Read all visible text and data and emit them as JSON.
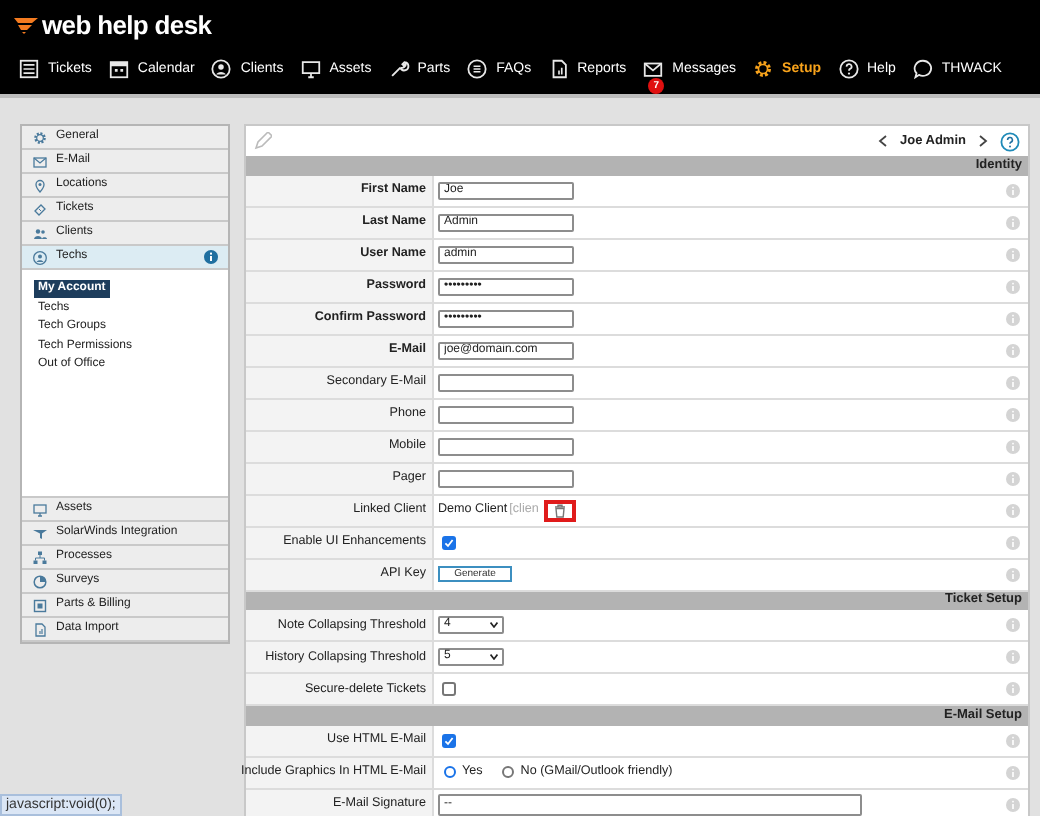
{
  "logo": "web help desk",
  "nav": [
    {
      "label": "Tickets",
      "selected": false
    },
    {
      "label": "Calendar",
      "selected": false
    },
    {
      "label": "Clients",
      "selected": false
    },
    {
      "label": "Assets",
      "selected": false
    },
    {
      "label": "Parts",
      "selected": false
    },
    {
      "label": "FAQs",
      "selected": false
    },
    {
      "label": "Reports",
      "selected": false
    },
    {
      "label": "Messages",
      "selected": false,
      "badge": "7"
    },
    {
      "label": "Setup",
      "selected": true
    },
    {
      "label": "Help",
      "selected": false
    },
    {
      "label": "THWACK",
      "selected": false
    }
  ],
  "sidebar": {
    "top_items": [
      {
        "label": "General",
        "selected": false
      },
      {
        "label": "E-Mail",
        "selected": false
      },
      {
        "label": "Locations",
        "selected": false
      },
      {
        "label": "Tickets",
        "selected": false
      },
      {
        "label": "Clients",
        "selected": false
      },
      {
        "label": "Techs",
        "selected": true,
        "info": true
      }
    ],
    "sub_items": [
      {
        "label": "My Account",
        "selected": true
      },
      {
        "label": "Techs",
        "selected": false
      },
      {
        "label": "Tech Groups",
        "selected": false
      },
      {
        "label": "Tech Permissions",
        "selected": false
      },
      {
        "label": "Out of Office",
        "selected": false
      }
    ],
    "bottom_items": [
      {
        "label": "Assets",
        "selected": false
      },
      {
        "label": "SolarWinds Integration",
        "selected": false
      },
      {
        "label": "Processes",
        "selected": false
      },
      {
        "label": "Surveys",
        "selected": false
      },
      {
        "label": "Parts & Billing",
        "selected": false
      },
      {
        "label": "Data Import",
        "selected": false
      }
    ]
  },
  "record": {
    "name": "Joe Admin"
  },
  "sections": [
    {
      "title": "Identity",
      "rows": [
        {
          "label": "First Name",
          "required": true,
          "kind": "text",
          "value": "Joe"
        },
        {
          "label": "Last Name",
          "required": true,
          "kind": "text",
          "value": "Admin"
        },
        {
          "label": "User Name",
          "required": true,
          "kind": "text",
          "value": "admin"
        },
        {
          "label": "Password",
          "required": true,
          "kind": "text",
          "value": "•••••••••"
        },
        {
          "label": "Confirm Password",
          "required": true,
          "kind": "text",
          "value": "•••••••••"
        },
        {
          "label": "E-Mail",
          "required": true,
          "kind": "text",
          "value": "joe@domain.com"
        },
        {
          "label": "Secondary E-Mail",
          "required": false,
          "kind": "text"
        },
        {
          "label": "Phone",
          "required": false,
          "kind": "text"
        },
        {
          "label": "Mobile",
          "required": false,
          "kind": "text"
        },
        {
          "label": "Pager",
          "required": false,
          "kind": "text"
        },
        {
          "label": "Linked Client",
          "required": false,
          "kind": "linked",
          "value": "Demo Client",
          "note": "[clien",
          "highlighted": true
        },
        {
          "label": "Enable UI Enhancements",
          "required": false,
          "kind": "checkbox",
          "checked": true
        },
        {
          "label": "API Key",
          "required": false,
          "kind": "button",
          "button": "Generate"
        }
      ]
    },
    {
      "title": "Ticket Setup",
      "rows": [
        {
          "label": "Note Collapsing Threshold",
          "required": false,
          "kind": "select",
          "value": "4"
        },
        {
          "label": "History Collapsing Threshold",
          "required": false,
          "kind": "select",
          "value": "5"
        },
        {
          "label": "Secure-delete Tickets",
          "required": false,
          "kind": "checkbox",
          "checked": false
        }
      ]
    },
    {
      "title": "E-Mail Setup",
      "rows": [
        {
          "label": "Use HTML E-Mail",
          "required": false,
          "kind": "checkbox",
          "checked": true
        },
        {
          "label": "Include Graphics In HTML E-Mail",
          "required": false,
          "kind": "radio",
          "options": [
            {
              "label": "Yes",
              "selected": true
            },
            {
              "label": "No (GMail/Outlook friendly)",
              "selected": false
            }
          ]
        },
        {
          "label": "E-Mail Signature",
          "required": false,
          "kind": "textarea",
          "value": "--"
        }
      ]
    }
  ],
  "status_bar": "javascript:void(0);"
}
